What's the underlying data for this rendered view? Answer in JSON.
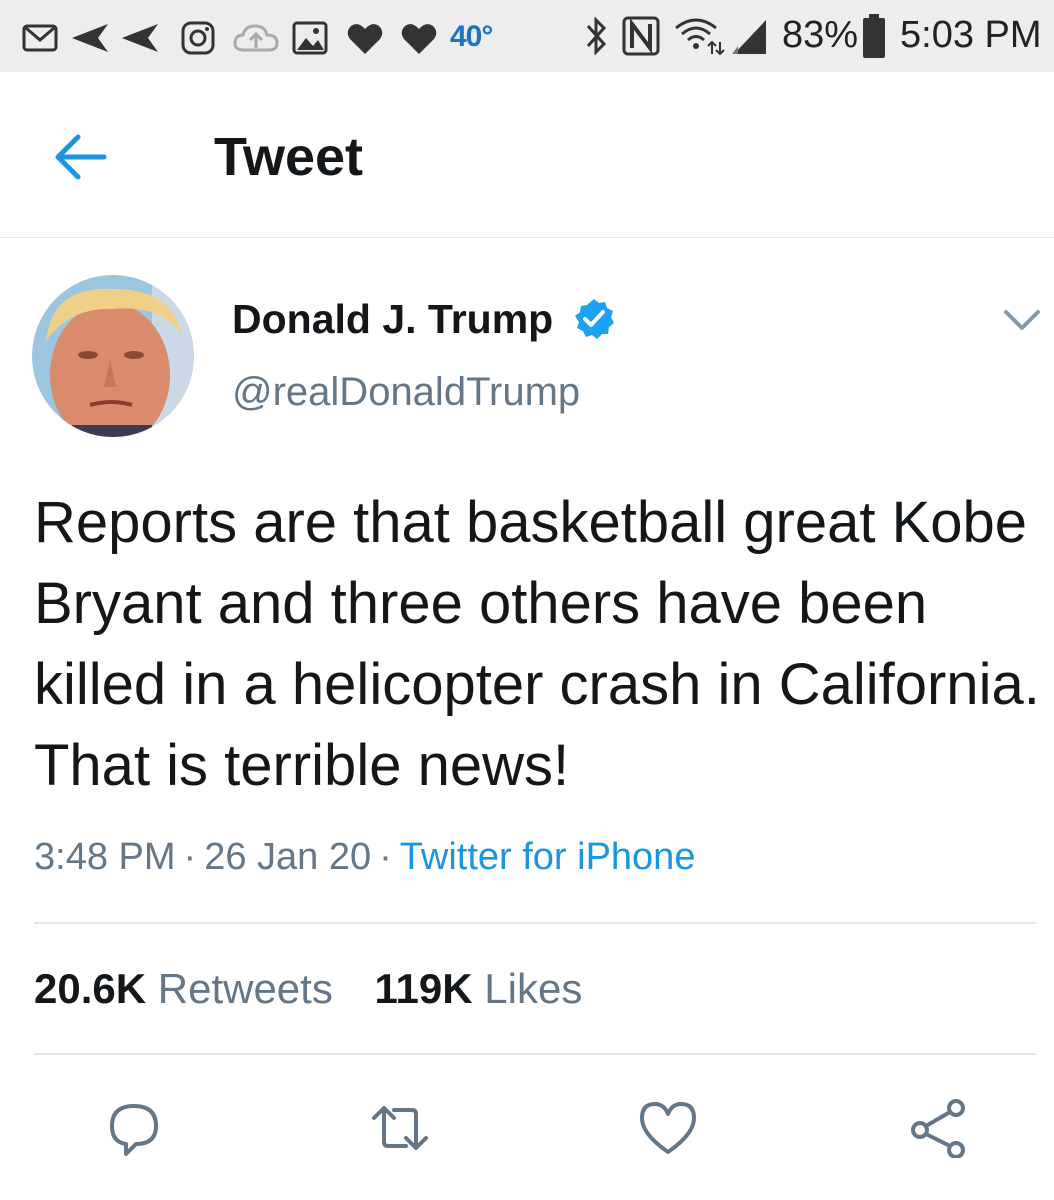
{
  "status_bar": {
    "temperature": "40°",
    "battery_percent": "83%",
    "time": "5:03 PM",
    "icons": [
      "gmail-icon",
      "send-icon",
      "send-icon",
      "instagram-icon",
      "cloud-upload-icon",
      "image-icon",
      "heart-icon",
      "heart-icon",
      "bluetooth-icon",
      "nfc-icon",
      "wifi-icon",
      "signal-icon",
      "battery-icon"
    ]
  },
  "header": {
    "title": "Tweet",
    "back_icon": "arrow-left-icon"
  },
  "tweet": {
    "author_name": "Donald J. Trump",
    "author_handle": "@realDonaldTrump",
    "verified": true,
    "text": "Reports are that basketball great Kobe Bryant and three others have been killed in a helicopter crash in California. That is terrible news!",
    "time": "3:48 PM",
    "date": "26 Jan 20",
    "separator": "·",
    "source": "Twitter for iPhone",
    "retweets_count": "20.6K",
    "retweets_label": "Retweets",
    "likes_count": "119K",
    "likes_label": "Likes"
  },
  "actions": [
    "reply-icon",
    "retweet-icon",
    "like-icon",
    "share-icon"
  ],
  "colors": {
    "accent": "#1b95e0",
    "verified": "#1da1f2",
    "secondary_text": "#657786",
    "primary_text": "#14171a",
    "divider": "#e1e8ed",
    "status_bar_bg": "#ededed"
  }
}
